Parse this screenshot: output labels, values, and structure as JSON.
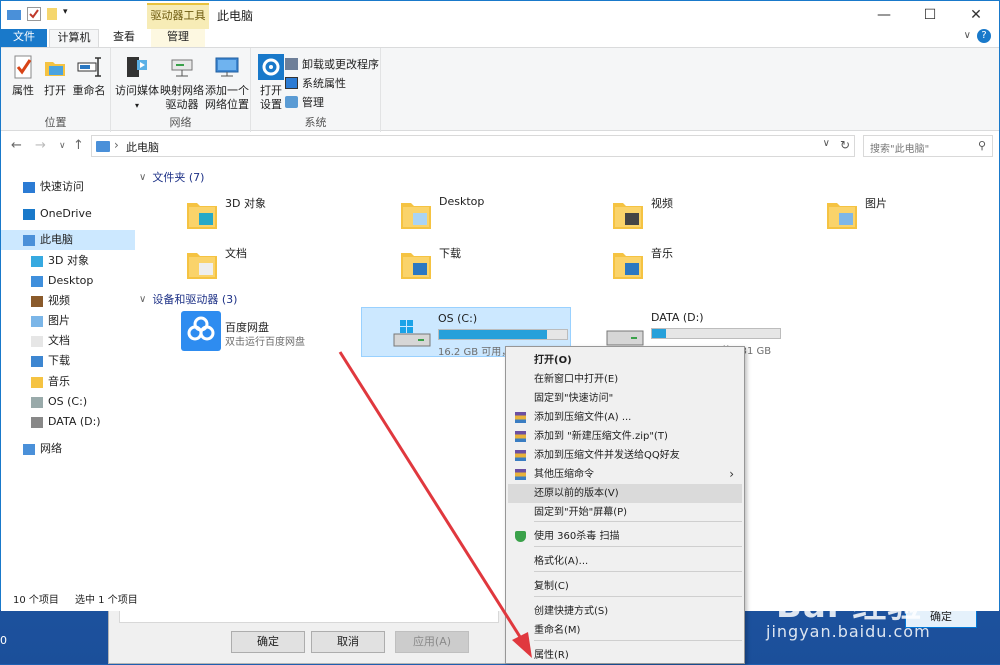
{
  "window": {
    "title": "此电脑",
    "context_tab_group": "驱动器工具",
    "controls": [
      "—",
      "☐",
      "✕"
    ]
  },
  "tabs": {
    "file": "文件",
    "computer": "计算机",
    "view": "查看",
    "manage": "管理",
    "collapse": "∨",
    "help": "?"
  },
  "ribbon": {
    "location": {
      "label": "位置",
      "properties": "属性",
      "open": "打开",
      "rename": "重命名"
    },
    "network": {
      "label": "网络",
      "access_media": "访问媒体",
      "map_drive_1": "映射网络",
      "map_drive_2": "驱动器",
      "add_location_1": "添加一个",
      "add_location_2": "网络位置"
    },
    "system": {
      "label": "系统",
      "open_settings_1": "打开",
      "open_settings_2": "设置",
      "uninstall": "卸载或更改程序",
      "system_properties": "系统属性",
      "manage": "管理"
    }
  },
  "address": {
    "path": "此电脑",
    "search_placeholder": "搜索\"此电脑\""
  },
  "nav": [
    {
      "label": "快速访问",
      "indent": 0
    },
    {
      "label": "OneDrive",
      "indent": 0
    },
    {
      "label": "此电脑",
      "indent": 0
    },
    {
      "label": "3D 对象",
      "indent": 1
    },
    {
      "label": "Desktop",
      "indent": 1
    },
    {
      "label": "视频",
      "indent": 1
    },
    {
      "label": "图片",
      "indent": 1
    },
    {
      "label": "文档",
      "indent": 1
    },
    {
      "label": "下载",
      "indent": 1
    },
    {
      "label": "音乐",
      "indent": 1
    },
    {
      "label": "OS (C:)",
      "indent": 1
    },
    {
      "label": "DATA (D:)",
      "indent": 1
    },
    {
      "label": "网络",
      "indent": 0
    }
  ],
  "folders_section": "文件夹 (7)",
  "folders": [
    {
      "name": "3D 对象"
    },
    {
      "name": "Desktop"
    },
    {
      "name": "视频"
    },
    {
      "name": "图片"
    },
    {
      "name": "文档"
    },
    {
      "name": "下载"
    },
    {
      "name": "音乐"
    }
  ],
  "devices_section": "设备和驱动器 (3)",
  "devices": [
    {
      "name": "百度网盘",
      "sub": "双击运行百度网盘"
    },
    {
      "name": "OS (C:)",
      "sub": "16.2 GB 可用，共 103 GB",
      "used_fraction": 0.84
    },
    {
      "name": "DATA (D:)",
      "sub": "827 GB 可用，共 931 GB",
      "used_fraction": 0.11
    }
  ],
  "status": {
    "count": "10 个项目",
    "selected": "选中 1 个项目"
  },
  "context_menu": [
    {
      "label": "打开(O)",
      "bold": true
    },
    {
      "label": "在新窗口中打开(E)"
    },
    {
      "label": "固定到\"快速访问\""
    },
    {
      "label": "添加到压缩文件(A) ...",
      "icon": "archive-icon"
    },
    {
      "label": "添加到 \"新建压缩文件.zip\"(T)",
      "icon": "archive-icon"
    },
    {
      "label": "添加到压缩文件并发送给QQ好友",
      "icon": "archive-icon"
    },
    {
      "label": "其他压缩命令",
      "icon": "archive-icon",
      "submenu": true
    },
    {
      "label": "还原以前的版本(V)",
      "hover": true
    },
    {
      "label": "固定到\"开始\"屏幕(P)"
    },
    {
      "label": "使用 360杀毒 扫描",
      "icon": "shield-icon"
    },
    {
      "label": "格式化(A)..."
    },
    {
      "label": "复制(C)"
    },
    {
      "label": "创建快捷方式(S)"
    },
    {
      "label": "重命名(M)"
    },
    {
      "label": "属性(R)"
    }
  ],
  "background_dialog": {
    "ok": "确定",
    "cancel": "取消",
    "apply": "应用(A)",
    "right_ok": "确定",
    "left_fragment": "0"
  },
  "watermark": {
    "text": "Bai 经验",
    "sub": "jingyan.baidu.com"
  },
  "colors": {
    "accent": "#1979ca",
    "selection": "#cce8ff",
    "drive_fill": "#26a0da",
    "arrow": "#e0383e"
  }
}
